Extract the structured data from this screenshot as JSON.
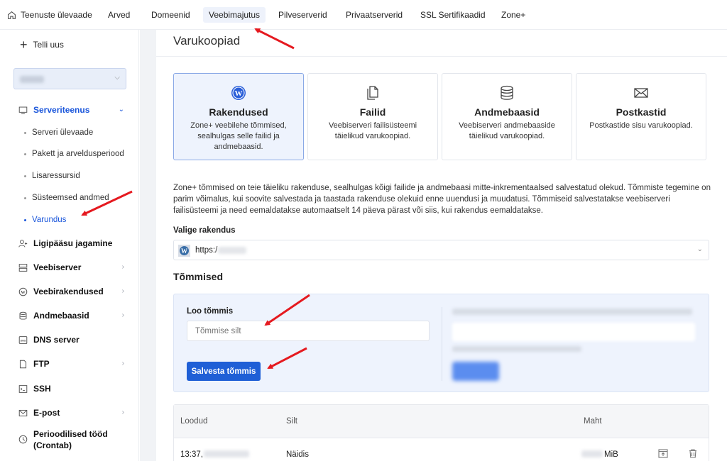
{
  "topnav": {
    "home_label": "Teenuste ülevaade",
    "items": [
      "Arved",
      "Domeenid",
      "Veebimajutus",
      "Pilveserverid",
      "Privaatserverid",
      "SSL Sertifikaadid",
      "Zone+"
    ],
    "active": "Veebimajutus"
  },
  "sidebar": {
    "order_new": "Telli uus",
    "service_section": "Serveriteenus",
    "sub_items": [
      "Serveri ülevaade",
      "Pakett ja arveldusperiood",
      "Lisaressursid",
      "Süsteemsed andmed",
      "Varundus"
    ],
    "active_sub": "Varundus",
    "sections": [
      {
        "label": "Ligipääsu jagamine",
        "icon": "user-plus-icon",
        "arrow": false
      },
      {
        "label": "Veebiserver",
        "icon": "server-icon",
        "arrow": true
      },
      {
        "label": "Veebirakendused",
        "icon": "wordpress-icon",
        "arrow": true
      },
      {
        "label": "Andmebaasid",
        "icon": "database-icon",
        "arrow": true
      },
      {
        "label": "DNS server",
        "icon": "dns-icon",
        "arrow": false
      },
      {
        "label": "FTP",
        "icon": "file-icon",
        "arrow": true
      },
      {
        "label": "SSH",
        "icon": "terminal-icon",
        "arrow": false
      },
      {
        "label": "E-post",
        "icon": "mail-icon",
        "arrow": true
      }
    ],
    "cron_line1": "Perioodilised tööd",
    "cron_line2": "(Crontab)"
  },
  "main": {
    "title": "Varukoopiad",
    "cards": [
      {
        "title": "Rakendused",
        "desc": "Zone+ veebilehe tõmmised, sealhulgas selle failid ja andmebaasid.",
        "icon": "wordpress-icon"
      },
      {
        "title": "Failid",
        "desc": "Veebiserveri failisüsteemi täielikud varukoopiad.",
        "icon": "files-icon"
      },
      {
        "title": "Andmebaasid",
        "desc": "Veebiserveri andmebaaside täielikud varukoopiad.",
        "icon": "database-icon"
      },
      {
        "title": "Postkastid",
        "desc": "Postkastide sisu varukoopiad.",
        "icon": "mail-icon"
      }
    ],
    "intro": "Zone+ tõmmised on teie täieliku rakenduse, sealhulgas kõigi failide ja andmebaasi mitte-inkrementaalsed salvestatud olekud. Tõmmiste tegemine on parim võimalus, kui soovite salvestada ja taastada rakenduse olekuid enne uuendusi ja muudatusi. Tõmmiseid salvestatakse veebiserveri failisüsteemi ja need eemaldatakse automaatselt 14 päeva pärast või siis, kui rakendus eemaldatakse.",
    "choose_label": "Valige rakendus",
    "app_url": "https:/",
    "snapshots_heading": "Tõmmised",
    "create_label": "Loo tõmmis",
    "input_placeholder": "Tõmmise silt",
    "save_button": "Salvesta tõmmis",
    "table": {
      "headers": [
        "Loodud",
        "Silt",
        "Maht"
      ],
      "rows": [
        {
          "created": "13:37,",
          "label": "Näidis",
          "size_unit": "MiB"
        }
      ]
    }
  },
  "colors": {
    "accent": "#1f5fd6",
    "arrow": "#e5191f",
    "active_bg": "#eef3fd"
  }
}
